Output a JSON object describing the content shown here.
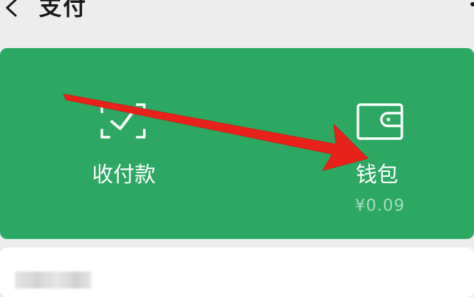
{
  "header": {
    "title": "支付"
  },
  "services": {
    "pay": {
      "label": "收付款"
    },
    "wallet": {
      "label": "钱包",
      "balance": "¥0.09"
    }
  },
  "colors": {
    "card_green": "#2ca862",
    "annotation_arrow": "#e8221b"
  },
  "icons": {
    "back": "chevron-left-icon",
    "more": "more-dots-icon",
    "pay": "scan-check-icon",
    "wallet": "wallet-icon"
  }
}
